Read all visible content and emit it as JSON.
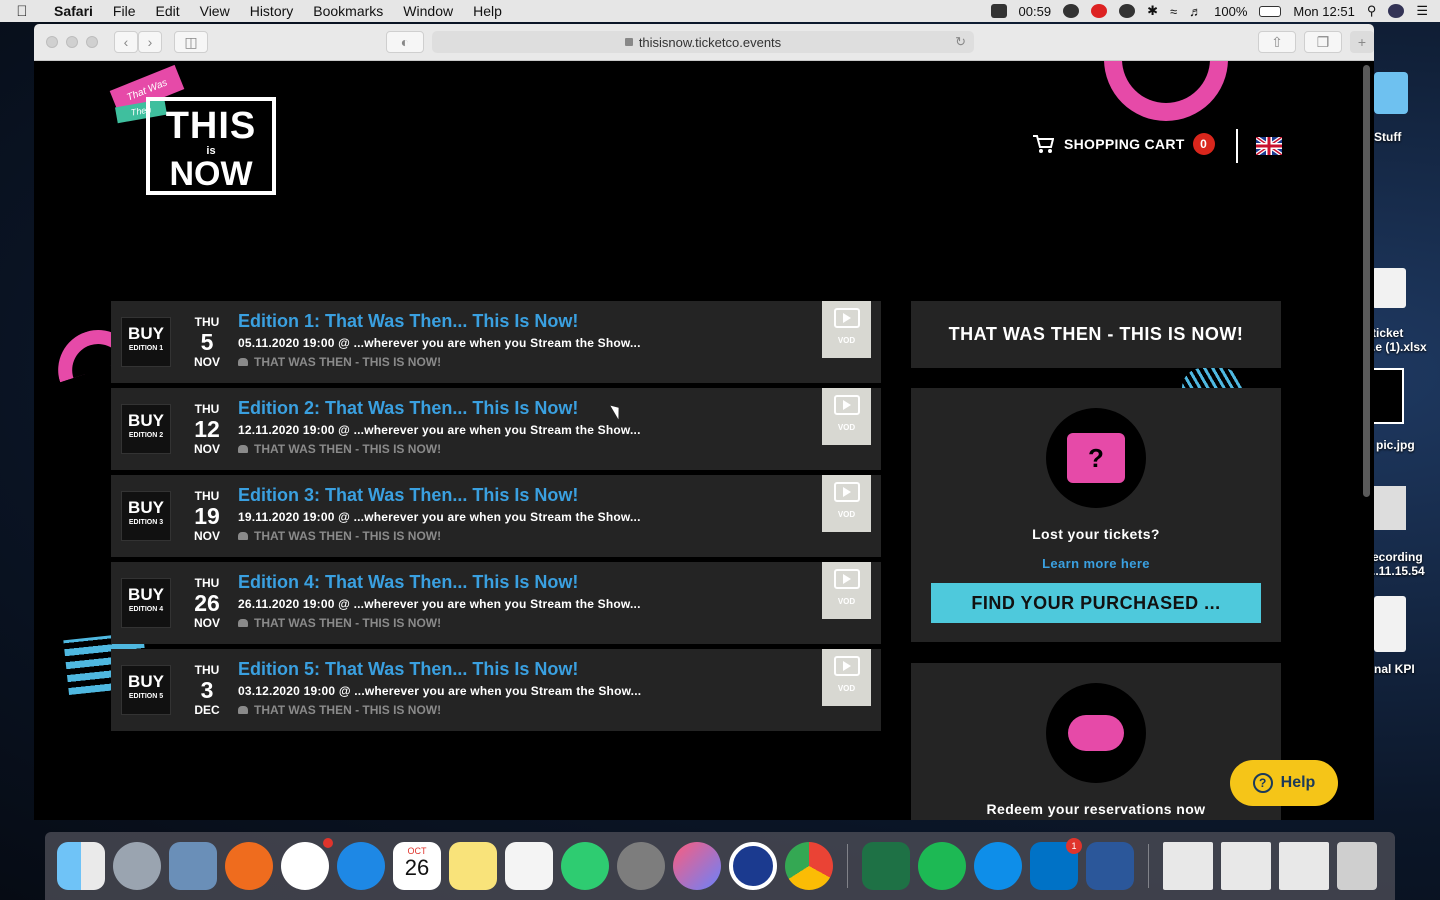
{
  "menubar": {
    "app_name": "Safari",
    "menus": [
      "File",
      "Edit",
      "View",
      "History",
      "Bookmarks",
      "Window",
      "Help"
    ],
    "timer": "00:59",
    "battery": "100%",
    "clock": "Mon 12:51"
  },
  "desktop": {
    "items": [
      "Stuff",
      "ticket\n.e (1).xlsx",
      "pic.jpg",
      "ecording\n..11.15.54",
      "nal KPI"
    ]
  },
  "browser": {
    "url": "thisisnow.ticketco.events"
  },
  "header": {
    "logo": {
      "banner": "That Was",
      "banner2": "Then",
      "this": "THIS",
      "is": "is",
      "now": "NOW"
    },
    "cart_label": "SHOPPING CART",
    "cart_count": "0"
  },
  "events": [
    {
      "thumb_buy": "BUY",
      "thumb_edition": "EDITION 1",
      "dow": "THU",
      "day": "5",
      "month": "NOV",
      "title": "Edition 1: That Was Then... This Is Now!",
      "subtitle": "05.11.2020 19:00 @ ...wherever you are when you Stream the Show...",
      "organizer": "THAT WAS THEN - THIS IS NOW!",
      "vod": "VOD"
    },
    {
      "thumb_buy": "BUY",
      "thumb_edition": "EDITION 2",
      "dow": "THU",
      "day": "12",
      "month": "NOV",
      "title": "Edition 2: That Was Then... This Is Now!",
      "subtitle": "12.11.2020 19:00 @ ...wherever you are when you Stream the Show...",
      "organizer": "THAT WAS THEN - THIS IS NOW!",
      "vod": "VOD"
    },
    {
      "thumb_buy": "BUY",
      "thumb_edition": "EDITION 3",
      "dow": "THU",
      "day": "19",
      "month": "NOV",
      "title": "Edition 3: That Was Then... This Is Now!",
      "subtitle": "19.11.2020 19:00 @ ...wherever you are when you Stream the Show...",
      "organizer": "THAT WAS THEN - THIS IS NOW!",
      "vod": "VOD"
    },
    {
      "thumb_buy": "BUY",
      "thumb_edition": "EDITION 4",
      "dow": "THU",
      "day": "26",
      "month": "NOV",
      "title": "Edition 4: That Was Then... This Is Now!",
      "subtitle": "26.11.2020 19:00 @ ...wherever you are when you Stream the Show...",
      "organizer": "THAT WAS THEN - THIS IS NOW!",
      "vod": "VOD"
    },
    {
      "thumb_buy": "BUY",
      "thumb_edition": "EDITION 5",
      "dow": "THU",
      "day": "3",
      "month": "DEC",
      "title": "Edition 5: That Was Then... This Is Now!",
      "subtitle": "03.12.2020 19:00 @ ...wherever you are when you Stream the Show...",
      "organizer": "THAT WAS THEN - THIS IS NOW!",
      "vod": "VOD"
    }
  ],
  "sidebar": {
    "title": "THAT WAS THEN - THIS IS NOW!",
    "lost": {
      "icon_glyph": "?",
      "heading": "Lost your tickets?",
      "link": "Learn more here",
      "button": "FIND YOUR PURCHASED ..."
    },
    "redeem": {
      "heading": "Redeem your reservations now"
    }
  },
  "help_label": "Help",
  "dock": {
    "calendar_month": "OCT",
    "calendar_day": "26",
    "slack_badge": "",
    "outlook_badge": "1"
  },
  "colors": {
    "accent_blue": "#3aa0e0",
    "pink": "#e64aa8",
    "cyan_button": "#4ec9dc",
    "help_yellow": "#f5c518",
    "cart_badge": "#d9261c"
  }
}
